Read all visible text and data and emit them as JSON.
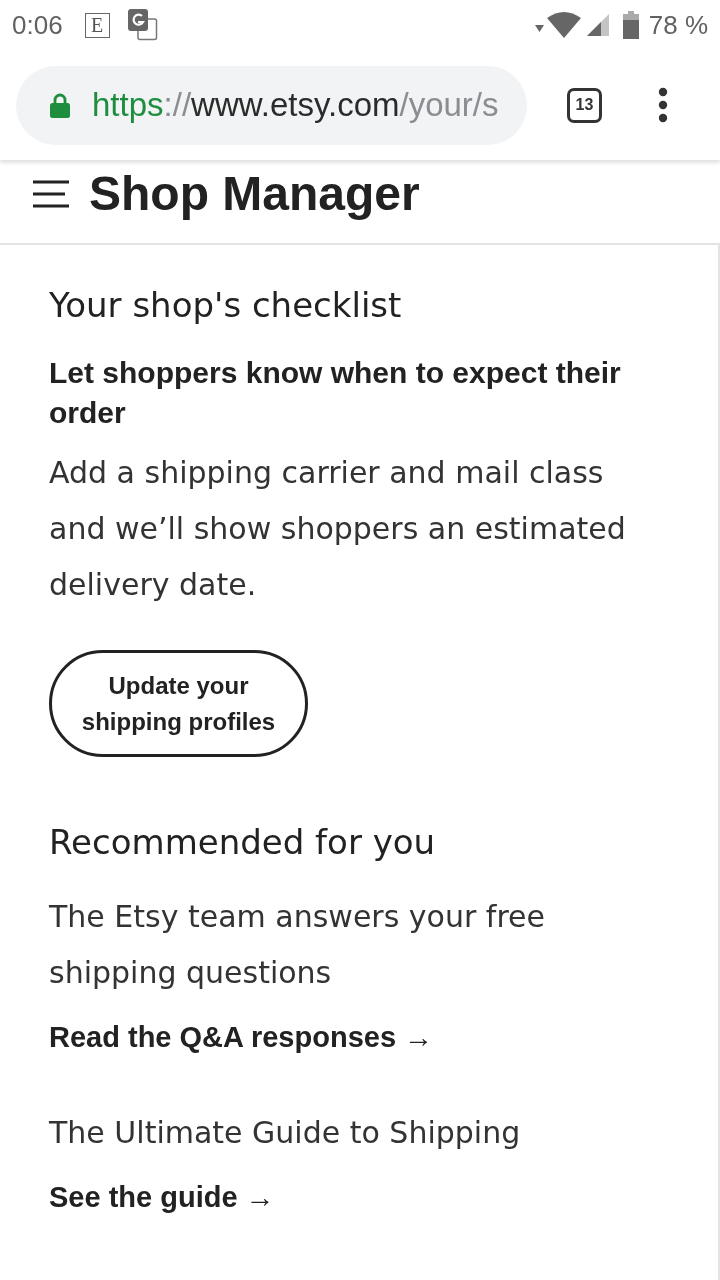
{
  "status_bar": {
    "time": "0:06",
    "notifications": [
      {
        "kind": "letter",
        "text": "E"
      },
      {
        "kind": "translate"
      }
    ],
    "battery": "78 %"
  },
  "browser": {
    "secure": true,
    "url": [
      {
        "kind": "scheme",
        "text": "https"
      },
      {
        "kind": "dim",
        "text": "://"
      },
      {
        "kind": "host",
        "text": "www.etsy.com"
      },
      {
        "kind": "dim",
        "text": "/your/s"
      }
    ],
    "tab_count": "13"
  },
  "header": {
    "title": "Shop Manager"
  },
  "checklist": {
    "title": "Your shop's checklist",
    "subtitle": "Let shoppers know when to expect their order",
    "body": "Add a shipping carrier and mail class and we’ll show shoppers an estimated delivery date.",
    "button": "Update your shipping profiles"
  },
  "recommended": {
    "title": "Recommended for you",
    "items": [
      {
        "text": "The Etsy team answers your free shipping questions",
        "link": "Read the Q&A responses →"
      },
      {
        "text": "The Ultimate Guide to Shipping",
        "link": "See the guide →"
      }
    ]
  }
}
